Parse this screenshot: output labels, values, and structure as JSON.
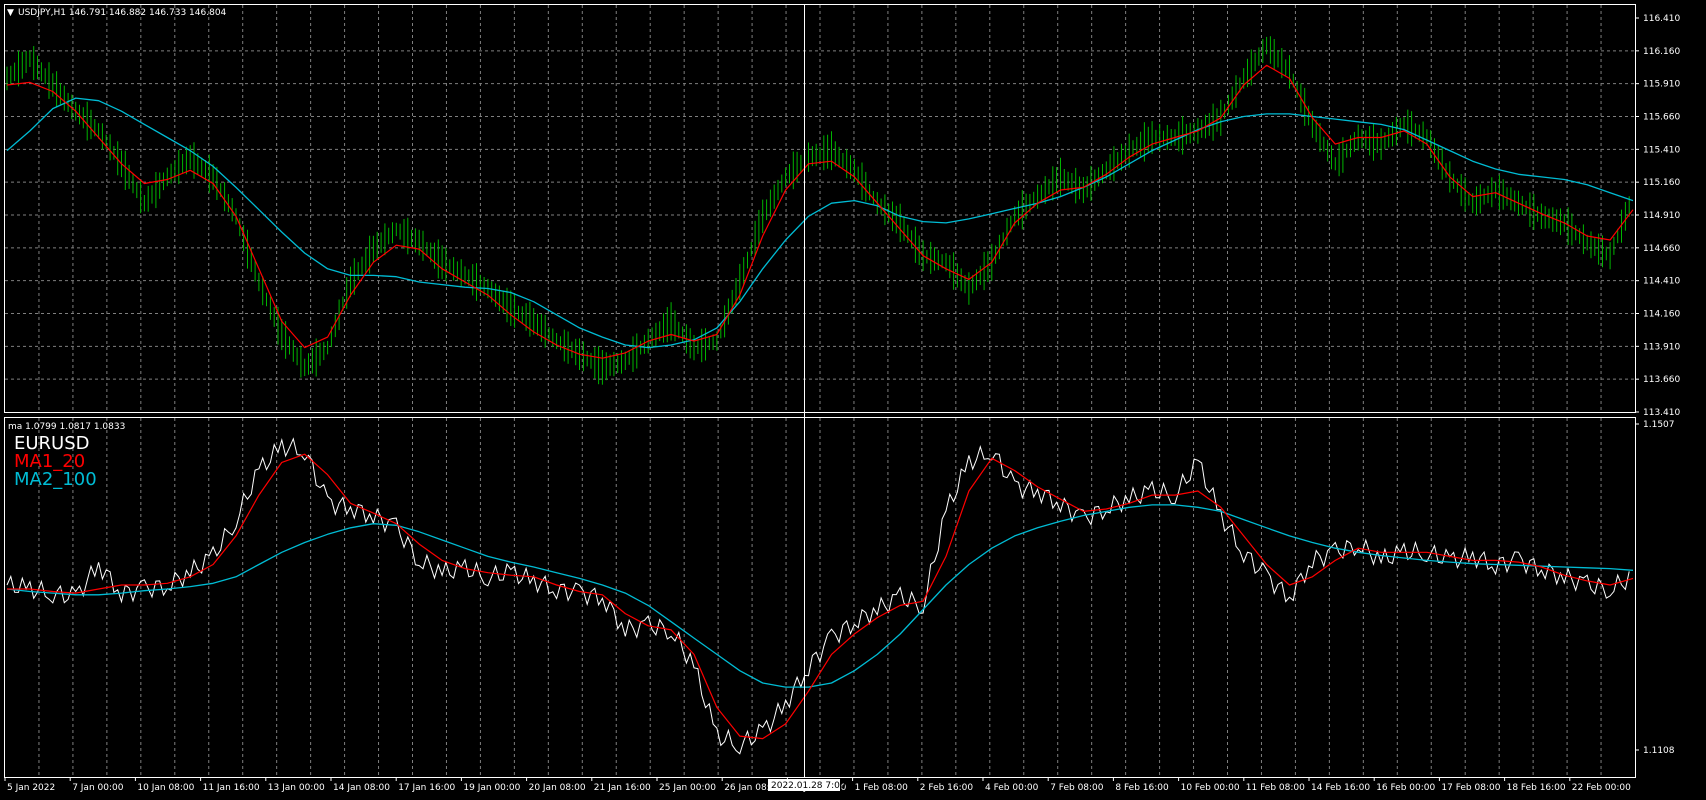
{
  "main_chart": {
    "header": "USDJPY,H1  146.791 146.882 146.733 146.804",
    "header_icon": "dropdown-triangle-icon",
    "price_axis": [
      "116.410",
      "116.160",
      "115.910",
      "115.660",
      "115.410",
      "115.160",
      "114.910",
      "114.660",
      "114.410",
      "114.160",
      "113.910",
      "113.660",
      "113.410"
    ],
    "price_range": [
      113.41,
      116.41
    ],
    "colors": {
      "background": "#000000",
      "grid": "#7f7f7f",
      "bars": "#00b400",
      "ma_fast": "#ff0000",
      "ma_slow": "#00bcd4"
    },
    "series": {
      "close": [
        115.95,
        116.1,
        115.9,
        115.7,
        115.55,
        115.3,
        115.0,
        115.2,
        115.35,
        115.2,
        114.9,
        114.4,
        114.0,
        113.75,
        113.9,
        114.4,
        114.65,
        114.8,
        114.7,
        114.55,
        114.45,
        114.35,
        114.2,
        114.1,
        113.95,
        113.85,
        113.75,
        113.8,
        113.95,
        114.1,
        113.9,
        113.95,
        114.4,
        114.9,
        115.2,
        115.35,
        115.4,
        115.25,
        115.0,
        114.85,
        114.6,
        114.55,
        114.35,
        114.55,
        114.9,
        115.05,
        115.2,
        115.1,
        115.25,
        115.4,
        115.5,
        115.5,
        115.55,
        115.65,
        115.95,
        116.2,
        116.0,
        115.6,
        115.3,
        115.5,
        115.45,
        115.6,
        115.5,
        115.2,
        115.0,
        115.1,
        115.0,
        114.9,
        114.85,
        114.7,
        114.6,
        115.05
      ],
      "ma_fast": [
        115.9,
        115.92,
        115.85,
        115.7,
        115.5,
        115.3,
        115.15,
        115.18,
        115.25,
        115.15,
        114.9,
        114.5,
        114.1,
        113.9,
        113.98,
        114.3,
        114.55,
        114.68,
        114.65,
        114.5,
        114.4,
        114.3,
        114.15,
        114.02,
        113.92,
        113.85,
        113.82,
        113.86,
        113.95,
        114.0,
        113.95,
        114.0,
        114.3,
        114.75,
        115.1,
        115.3,
        115.32,
        115.2,
        115.0,
        114.8,
        114.6,
        114.5,
        114.42,
        114.55,
        114.85,
        115.0,
        115.1,
        115.12,
        115.22,
        115.35,
        115.45,
        115.5,
        115.55,
        115.65,
        115.9,
        116.05,
        115.95,
        115.65,
        115.45,
        115.5,
        115.5,
        115.55,
        115.45,
        115.2,
        115.05,
        115.08,
        115.0,
        114.92,
        114.85,
        114.75,
        114.72,
        114.95
      ],
      "ma_slow": [
        115.4,
        115.55,
        115.72,
        115.8,
        115.78,
        115.7,
        115.6,
        115.5,
        115.4,
        115.28,
        115.12,
        114.95,
        114.78,
        114.62,
        114.5,
        114.45,
        114.45,
        114.44,
        114.4,
        114.38,
        114.36,
        114.35,
        114.32,
        114.25,
        114.15,
        114.05,
        113.98,
        113.92,
        113.9,
        113.92,
        113.96,
        114.05,
        114.25,
        114.5,
        114.72,
        114.9,
        115.0,
        115.02,
        114.98,
        114.9,
        114.86,
        114.85,
        114.88,
        114.92,
        114.96,
        115.0,
        115.05,
        115.12,
        115.2,
        115.3,
        115.4,
        115.48,
        115.56,
        115.62,
        115.66,
        115.68,
        115.68,
        115.66,
        115.64,
        115.62,
        115.6,
        115.56,
        115.48,
        115.4,
        115.32,
        115.26,
        115.22,
        115.2,
        115.18,
        115.14,
        115.08,
        115.02
      ]
    }
  },
  "sub_chart": {
    "header": "ma 1.0799 1.0817 1.0833",
    "legend": [
      {
        "label": "EURUSD",
        "color": "#ffffff"
      },
      {
        "label": "MA1_20",
        "color": "#ff0000"
      },
      {
        "label": "MA2_100",
        "color": "#00bcd4"
      }
    ],
    "price_axis": [
      "1.1507",
      "1.1108"
    ],
    "price_range": [
      1.1108,
      1.1507
    ],
    "colors": {
      "line": "#ffffff",
      "ma_fast": "#ff0000",
      "ma_slow": "#00bcd4"
    },
    "series": {
      "close": [
        1.131,
        1.1305,
        1.13,
        1.1295,
        1.1335,
        1.13,
        1.1305,
        1.131,
        1.1325,
        1.1345,
        1.139,
        1.145,
        1.148,
        1.1475,
        1.141,
        1.1405,
        1.1395,
        1.138,
        1.134,
        1.1325,
        1.133,
        1.132,
        1.1325,
        1.1315,
        1.1305,
        1.13,
        1.1295,
        1.1255,
        1.126,
        1.1255,
        1.121,
        1.1125,
        1.1115,
        1.113,
        1.1165,
        1.121,
        1.1245,
        1.1265,
        1.128,
        1.1295,
        1.1285,
        1.14,
        1.146,
        1.1475,
        1.143,
        1.1425,
        1.141,
        1.139,
        1.1405,
        1.1415,
        1.1425,
        1.142,
        1.146,
        1.1395,
        1.135,
        1.132,
        1.1295,
        1.134,
        1.135,
        1.136,
        1.134,
        1.135,
        1.135,
        1.134,
        1.1345,
        1.1335,
        1.134,
        1.133,
        1.132,
        1.131,
        1.1305,
        1.132
      ],
      "ma_fast": [
        1.1305,
        1.1305,
        1.1302,
        1.13,
        1.1305,
        1.131,
        1.131,
        1.1312,
        1.132,
        1.1335,
        1.137,
        1.142,
        1.146,
        1.147,
        1.1445,
        1.141,
        1.1398,
        1.1385,
        1.136,
        1.134,
        1.133,
        1.1325,
        1.1322,
        1.132,
        1.131,
        1.1302,
        1.1298,
        1.1275,
        1.126,
        1.1255,
        1.1225,
        1.116,
        1.1125,
        1.1122,
        1.114,
        1.118,
        1.1225,
        1.125,
        1.127,
        1.1285,
        1.129,
        1.1345,
        1.1425,
        1.1465,
        1.145,
        1.143,
        1.1415,
        1.14,
        1.1403,
        1.141,
        1.142,
        1.142,
        1.1425,
        1.1405,
        1.137,
        1.1335,
        1.131,
        1.132,
        1.134,
        1.1355,
        1.135,
        1.135,
        1.135,
        1.1345,
        1.134,
        1.134,
        1.1338,
        1.1332,
        1.1322,
        1.1315,
        1.131,
        1.1318
      ],
      "ma_slow": [
        1.1305,
        1.1302,
        1.13,
        1.1298,
        1.1298,
        1.13,
        1.1303,
        1.1305,
        1.1308,
        1.1312,
        1.132,
        1.1335,
        1.135,
        1.1362,
        1.1372,
        1.138,
        1.1385,
        1.1383,
        1.1375,
        1.1365,
        1.1355,
        1.1345,
        1.1338,
        1.1332,
        1.1325,
        1.1318,
        1.131,
        1.13,
        1.1285,
        1.1265,
        1.1245,
        1.1225,
        1.1205,
        1.119,
        1.1185,
        1.1185,
        1.119,
        1.1205,
        1.1225,
        1.125,
        1.128,
        1.131,
        1.1335,
        1.1355,
        1.137,
        1.138,
        1.1388,
        1.1395,
        1.14,
        1.1405,
        1.1408,
        1.1408,
        1.1405,
        1.14,
        1.139,
        1.138,
        1.137,
        1.1362,
        1.1355,
        1.135,
        1.1346,
        1.1343,
        1.134,
        1.1338,
        1.1336,
        1.1335,
        1.1334,
        1.1333,
        1.1332,
        1.1331,
        1.133,
        1.1328
      ]
    }
  },
  "time_axis": [
    "5 Jan 2022",
    "7 Jan 00:00",
    "10 Jan 08:00",
    "11 Jan 16:00",
    "13 Jan 00:00",
    "14 Jan 08:00",
    "17 Jan 16:00",
    "19 Jan 00:00",
    "20 Jan 08:00",
    "21 Jan 16:00",
    "25 Jan 00:00",
    "26 Jan 08:00",
    "31 Jan 00:00",
    "1 Feb 08:00",
    "2 Feb 16:00",
    "4 Feb 00:00",
    "7 Feb 08:00",
    "8 Feb 16:00",
    "10 Feb 00:00",
    "11 Feb 08:00",
    "14 Feb 16:00",
    "16 Feb 00:00",
    "17 Feb 08:00",
    "18 Feb 16:00",
    "22 Feb 00:00"
  ],
  "crosshair_label": "2022.01.28 7:00"
}
